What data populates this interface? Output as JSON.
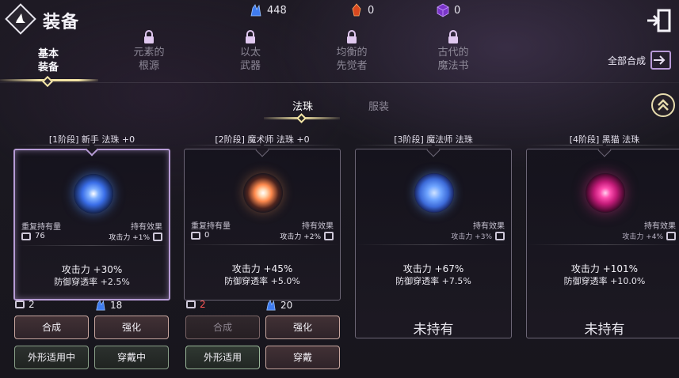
{
  "header": {
    "title": "装备",
    "currencies": [
      {
        "name": "blue-crystal",
        "value": "448",
        "color": "#3f7cf0"
      },
      {
        "name": "fire-gem",
        "value": "0",
        "color": "#e0542a"
      },
      {
        "name": "purple-cube",
        "value": "0",
        "color": "#9a4ce0"
      }
    ]
  },
  "category_tabs": [
    {
      "label": "基本\n装备",
      "line1": "基本",
      "line2": "装备",
      "state": "active"
    },
    {
      "line1": "元素的",
      "line2": "根源",
      "state": "locked"
    },
    {
      "line1": "以太",
      "line2": "武器",
      "state": "locked"
    },
    {
      "line1": "均衡的",
      "line2": "先觉者",
      "state": "locked"
    },
    {
      "line1": "古代的",
      "line2": "魔法书",
      "state": "locked"
    }
  ],
  "all_synth_label": "全部合成",
  "sub_tabs": [
    {
      "label": "法珠",
      "state": "active"
    },
    {
      "label": "服装",
      "state": "inactive"
    }
  ],
  "labels": {
    "hold_count": "重复持有量",
    "hold_effect": "持有效果"
  },
  "cards": [
    {
      "title": "[1阶段] 新手 法珠 +0",
      "hold": "76",
      "effect": "攻击力 +1%",
      "atk": "攻击力 +30%",
      "pen": "防御穿透率 +2.5%",
      "owned": true,
      "selected": true,
      "orb_color": "#4f8cff",
      "mat_chest": "2",
      "mat_chest_red": false,
      "mat_crystal": "18",
      "btn_synth": "合成",
      "btn_upgrade": "强化",
      "btn_skin": "外形适用中",
      "btn_wear": "穿戴中",
      "synth_dim": false
    },
    {
      "title": "[2阶段] 魔术师 法珠 +0",
      "hold": "0",
      "effect": "攻击力 +2%",
      "atk": "攻击力 +45%",
      "pen": "防御穿透率 +5.0%",
      "owned": true,
      "selected": false,
      "orb_color": "#ff9a5a",
      "mat_chest": "2",
      "mat_chest_red": true,
      "mat_crystal": "20",
      "btn_synth": "合成",
      "btn_upgrade": "强化",
      "btn_skin": "外形适用",
      "btn_wear": "穿戴",
      "synth_dim": true
    },
    {
      "title": "[3阶段] 魔法师 法珠",
      "effect": "攻击力 +3%",
      "atk": "攻击力 +67%",
      "pen": "防御穿透率 +7.5%",
      "owned": false,
      "orb_color": "#5b92f0",
      "not_owned_label": "未持有"
    },
    {
      "title": "[4阶段] 黑猫 法珠",
      "effect": "攻击力 +4%",
      "atk": "攻击力 +101%",
      "pen": "防御穿透率 +10.0%",
      "owned": false,
      "orb_color": "#e0308a",
      "not_owned_label": "未持有"
    }
  ]
}
